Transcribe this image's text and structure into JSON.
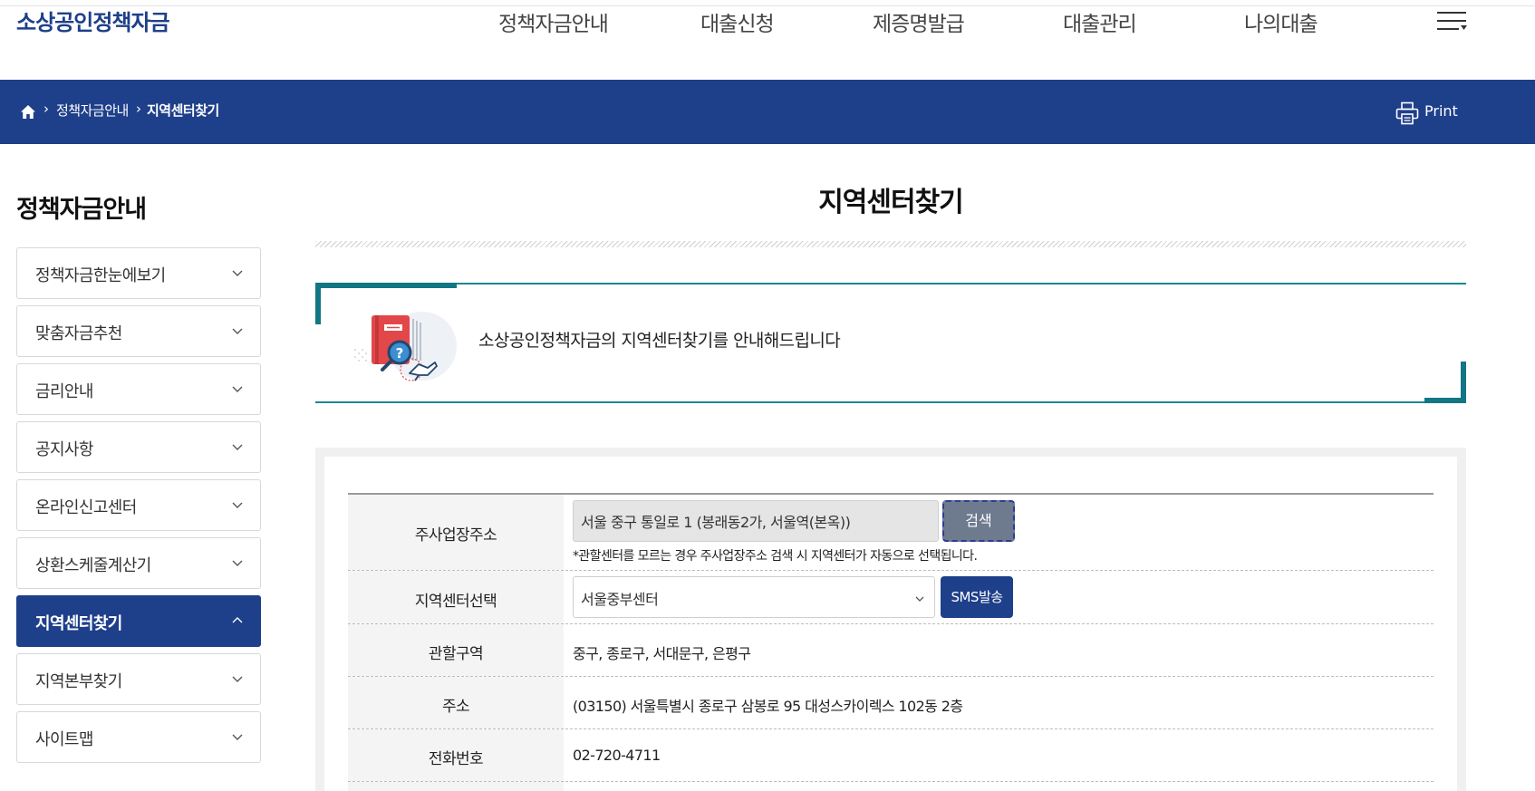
{
  "header": {
    "logo": "소상공인정책자금",
    "nav": [
      "정책자금안내",
      "대출신청",
      "제증명발급",
      "대출관리",
      "나의대출"
    ]
  },
  "breadcrumb": {
    "items": [
      "정책자금안내",
      "지역센터찾기"
    ],
    "print_label": "Print"
  },
  "sidebar": {
    "title": "정책자금안내",
    "items": [
      {
        "label": "정책자금한눈에보기"
      },
      {
        "label": "맞춤자금추천"
      },
      {
        "label": "금리안내"
      },
      {
        "label": "공지사항"
      },
      {
        "label": "온라인신고센터"
      },
      {
        "label": "상환스케줄계산기"
      },
      {
        "label": "지역센터찾기"
      },
      {
        "label": "지역본부찾기"
      },
      {
        "label": "사이트맵"
      }
    ],
    "active_index": 6
  },
  "main": {
    "title": "지역센터찾기",
    "intro": "소상공인정책자금의 지역센터찾기를 안내해드립니다",
    "form": {
      "address": {
        "label": "주사업장주소",
        "value": "서울 중구 통일로 1 (봉래동2가, 서울역(본옥))",
        "search_label": "검색",
        "hint": "*관할센터를 모르는 경우 주사업장주소 검색 시 지역센터가 자동으로 선택됩니다."
      },
      "center": {
        "label": "지역센터선택",
        "selected": "서울중부센터",
        "sms_label": "SMS발송"
      },
      "district": {
        "label": "관할구역",
        "value": "중구, 종로구, 서대문구, 은평구"
      },
      "addr": {
        "label": "주소",
        "value": "(03150) 서울특별시 종로구 삼봉로 95 대성스카이렉스 102동 2층"
      },
      "phone": {
        "label": "전화번호",
        "value": "02-720-4711"
      }
    }
  },
  "colors": {
    "brand_navy": "#1e3f8a",
    "accent_teal": "#127685",
    "search_button_gray": "#6e7a8e"
  },
  "icons": [
    "home-icon",
    "print-icon",
    "menu-icon",
    "chevron-down-icon",
    "chevron-up-icon"
  ]
}
